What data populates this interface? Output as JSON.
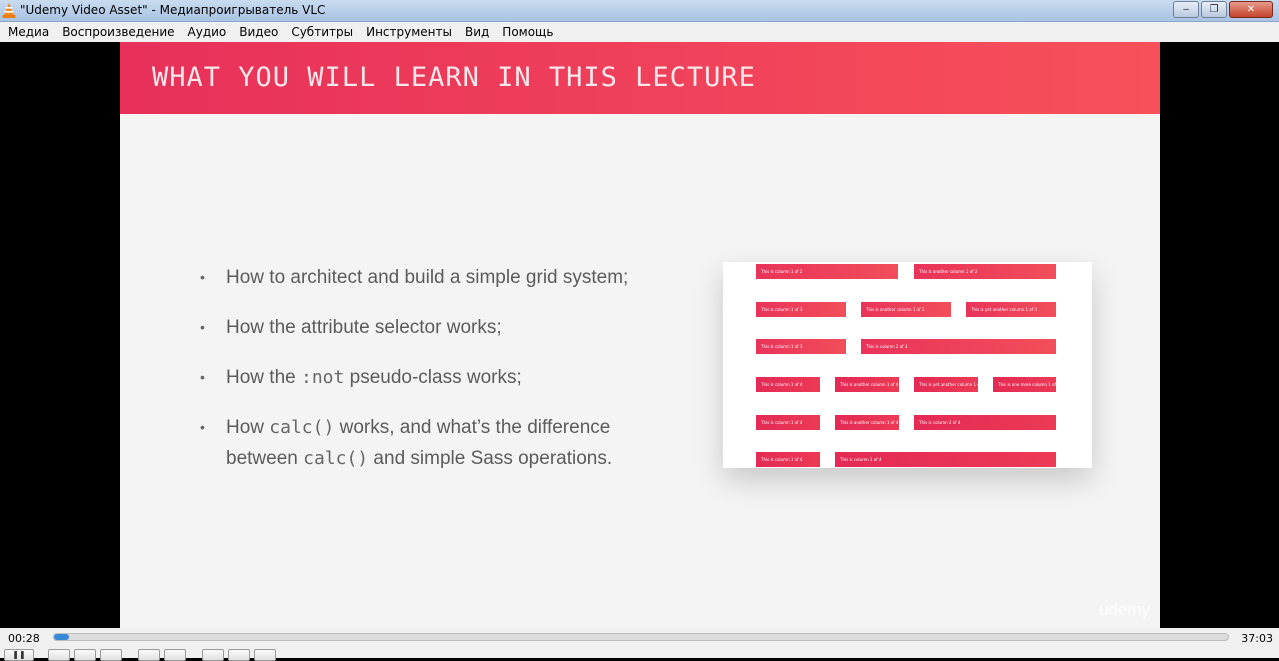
{
  "window": {
    "title": "\"Udemy Video Asset\" - Медиапроигрыватель VLC",
    "minimize": "‒",
    "maximize": "❐",
    "close": "✕"
  },
  "menu": [
    "Медиа",
    "Воспроизведение",
    "Аудио",
    "Видео",
    "Субтитры",
    "Инструменты",
    "Вид",
    "Помощь"
  ],
  "slide": {
    "title": "WHAT YOU WILL LEARN IN THIS LECTURE",
    "bullet_1": "How to architect and build a simple grid system;",
    "bullet_2": "How the attribute selector works;",
    "bullet_3_pre": "How the ",
    "bullet_3_code": ":not",
    "bullet_3_post": " pseudo-class works;",
    "bullet_4_pre": "How ",
    "bullet_4_code1": "calc()",
    "bullet_4_mid": " works, and what’s the difference between ",
    "bullet_4_code2": "calc()",
    "bullet_4_post": " and simple Sass operations.",
    "bullet_symbol": "•",
    "grid_cells": [
      "This is column 1 of 2",
      "This is another column 1 of 2",
      "This is column 1 of 3",
      "This is another column 1 of 3",
      "This is yet another column 1 of 3",
      "This is column 1 of 3",
      "This is column 2 of 3",
      "This is column 1 of 4",
      "This is another column 1 of 4",
      "This is yet another column 1 of 4",
      "This is one more column 1 of 4",
      "This is column 1 of 4",
      "This is another column 1 of 4",
      "This is column 2 of 4",
      "This is column 1 of 4",
      "This is column 3 of 4"
    ],
    "watermark": "udemy"
  },
  "player": {
    "elapsed": "00:28",
    "total": "37:03",
    "progress_fraction": 0.0126
  }
}
